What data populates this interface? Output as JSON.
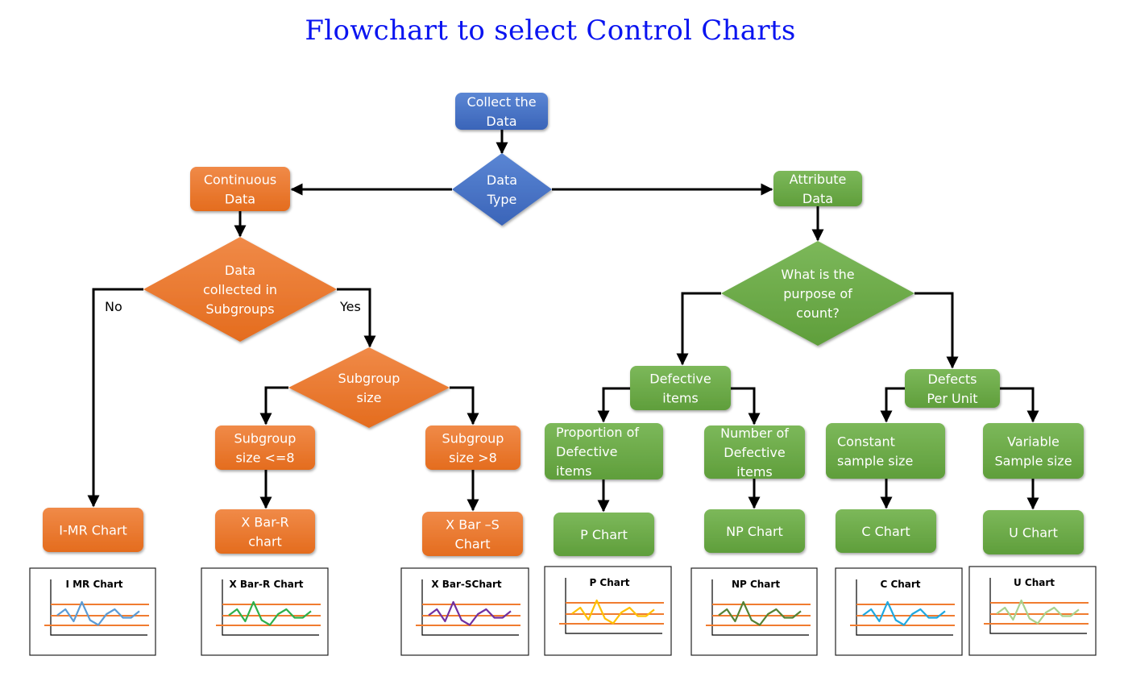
{
  "title": "Flowchart to select Control Charts",
  "colors": {
    "blue": "#4472c4",
    "orange": "#ed7d31",
    "green": "#70ad47",
    "title": "#0a14f0",
    "control_line": "#f07c30"
  },
  "nodes": {
    "collect_data": {
      "shape": "rect",
      "color": "blue",
      "lines": [
        "Collect the",
        "Data"
      ]
    },
    "data_type": {
      "shape": "diamond",
      "color": "blue",
      "lines": [
        "Data",
        "Type"
      ]
    },
    "continuous_data": {
      "shape": "rect",
      "color": "orange",
      "lines": [
        "Continuous",
        "Data"
      ]
    },
    "subgroups_decision": {
      "shape": "diamond",
      "color": "orange",
      "lines": [
        "Data",
        "collected in",
        "Subgroups"
      ]
    },
    "subgroup_size_decision": {
      "shape": "diamond",
      "color": "orange",
      "lines": [
        "Subgroup",
        "size"
      ]
    },
    "subgroup_le8": {
      "shape": "rect",
      "color": "orange",
      "lines": [
        "Subgroup",
        "size <=8"
      ]
    },
    "subgroup_gt8": {
      "shape": "rect",
      "color": "orange",
      "lines": [
        "Subgroup",
        "size >8"
      ]
    },
    "imr_chart": {
      "shape": "rect",
      "color": "orange",
      "lines": [
        "I-MR Chart"
      ]
    },
    "xbar_r_chart": {
      "shape": "rect",
      "color": "orange",
      "lines": [
        "X Bar-R",
        "chart"
      ]
    },
    "xbar_s_chart": {
      "shape": "rect",
      "color": "orange",
      "lines": [
        "X Bar –S",
        "Chart"
      ]
    },
    "attribute_data": {
      "shape": "rect",
      "color": "green",
      "lines": [
        "Attribute",
        "Data"
      ]
    },
    "purpose_decision": {
      "shape": "diamond",
      "color": "green",
      "lines": [
        "What is the",
        "purpose of",
        "count?"
      ]
    },
    "defective_items": {
      "shape": "rect",
      "color": "green",
      "lines": [
        "Defective",
        "items"
      ]
    },
    "defects_per_unit": {
      "shape": "rect",
      "color": "green",
      "lines": [
        "Defects",
        "Per Unit"
      ]
    },
    "proportion_defective": {
      "shape": "rect",
      "color": "green",
      "lines": [
        "Proportion of",
        "Defective",
        "items"
      ]
    },
    "number_defective": {
      "shape": "rect",
      "color": "green",
      "lines": [
        "Number of",
        "Defective",
        "items"
      ]
    },
    "constant_sample": {
      "shape": "rect",
      "color": "green",
      "lines": [
        "Constant",
        "sample size"
      ]
    },
    "variable_sample": {
      "shape": "rect",
      "color": "green",
      "lines": [
        "Variable",
        "Sample size"
      ]
    },
    "p_chart": {
      "shape": "rect",
      "color": "green",
      "lines": [
        "P Chart"
      ]
    },
    "np_chart": {
      "shape": "rect",
      "color": "green",
      "lines": [
        "NP Chart"
      ]
    },
    "c_chart": {
      "shape": "rect",
      "color": "green",
      "lines": [
        "C Chart"
      ]
    },
    "u_chart": {
      "shape": "rect",
      "color": "green",
      "lines": [
        "U Chart"
      ]
    }
  },
  "edges": [
    {
      "from": "collect_data",
      "to": "data_type"
    },
    {
      "from": "data_type",
      "to": "continuous_data"
    },
    {
      "from": "data_type",
      "to": "attribute_data"
    },
    {
      "from": "continuous_data",
      "to": "subgroups_decision"
    },
    {
      "from": "subgroups_decision",
      "to": "imr_chart",
      "label": "No"
    },
    {
      "from": "subgroups_decision",
      "to": "subgroup_size_decision",
      "label": "Yes"
    },
    {
      "from": "subgroup_size_decision",
      "to": "subgroup_le8"
    },
    {
      "from": "subgroup_size_decision",
      "to": "subgroup_gt8"
    },
    {
      "from": "subgroup_le8",
      "to": "xbar_r_chart"
    },
    {
      "from": "subgroup_gt8",
      "to": "xbar_s_chart"
    },
    {
      "from": "attribute_data",
      "to": "purpose_decision"
    },
    {
      "from": "purpose_decision",
      "to": "defective_items"
    },
    {
      "from": "purpose_decision",
      "to": "defects_per_unit"
    },
    {
      "from": "defective_items",
      "to": "proportion_defective"
    },
    {
      "from": "defective_items",
      "to": "number_defective"
    },
    {
      "from": "defects_per_unit",
      "to": "constant_sample"
    },
    {
      "from": "defects_per_unit",
      "to": "variable_sample"
    },
    {
      "from": "proportion_defective",
      "to": "p_chart"
    },
    {
      "from": "number_defective",
      "to": "np_chart"
    },
    {
      "from": "constant_sample",
      "to": "c_chart"
    },
    {
      "from": "variable_sample",
      "to": "u_chart"
    }
  ],
  "edge_labels": {
    "no": "No",
    "yes": "Yes"
  },
  "thumbnails": [
    {
      "title": "I MR Chart",
      "line_color": "#5b9bd5"
    },
    {
      "title": "X Bar-R  Chart",
      "line_color": "#2db04b"
    },
    {
      "title": "X Bar-SChart",
      "line_color": "#7030a0"
    },
    {
      "title": "P Chart",
      "line_color": "#ffc000"
    },
    {
      "title": "NP Chart",
      "line_color": "#548235"
    },
    {
      "title": "C Chart",
      "line_color": "#1fa8e0"
    },
    {
      "title": "U Chart",
      "line_color": "#a9d18e"
    }
  ],
  "thumbnail_series": [
    0.45,
    0.7,
    0.2,
    1.0,
    0.25,
    0.05,
    0.5,
    0.7,
    0.35,
    0.35,
    0.62
  ]
}
